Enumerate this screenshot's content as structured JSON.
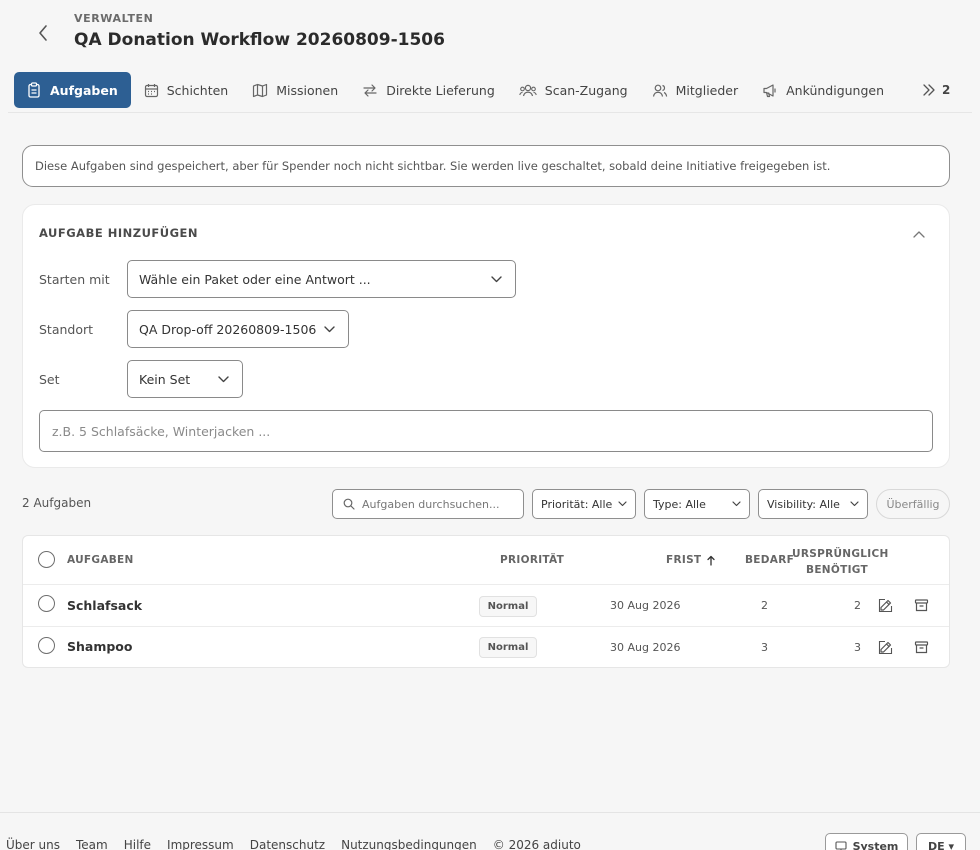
{
  "header": {
    "eyebrow": "VERWALTEN",
    "title": "QA Donation Workflow 20260809-1506"
  },
  "tabs": [
    {
      "label": "Aufgaben",
      "icon": "clipboard-icon",
      "active": true
    },
    {
      "label": "Schichten",
      "icon": "calendar-icon"
    },
    {
      "label": "Missionen",
      "icon": "map-icon"
    },
    {
      "label": "Direkte Lieferung",
      "icon": "arrows-exchange-icon"
    },
    {
      "label": "Scan-Zugang",
      "icon": "users-icon"
    },
    {
      "label": "Mitglieder",
      "icon": "user-icon"
    },
    {
      "label": "Ankündigungen",
      "icon": "megaphone-icon"
    }
  ],
  "tabs_more": {
    "count": "2",
    "icon": "double-chevron-right-icon"
  },
  "notice": "Diese Aufgaben sind gespeichert, aber für Spender noch nicht sichtbar. Sie werden live geschaltet, sobald deine Initiative freigegeben ist.",
  "add_task": {
    "title": "AUFGABE HINZUFÜGEN",
    "start_label": "Starten mit",
    "start_value": "Wähle ein Paket oder eine Antwort ...",
    "location_label": "Standort",
    "location_value": "QA Drop-off 20260809-1506",
    "set_label": "Set",
    "set_value": "Kein Set",
    "input_placeholder": "z.B. 5 Schlafsäcke, Winterjacken ..."
  },
  "toolbar": {
    "count": "2 Aufgaben",
    "search_placeholder": "Aufgaben durchsuchen...",
    "filter_priority": "Priorität: Alle",
    "filter_type": "Type: Alle",
    "filter_visibility": "Visibility: Alle",
    "overdue": "Überfällig"
  },
  "table": {
    "headers": {
      "task": "AUFGABEN",
      "priority": "PRIORITÄT",
      "due": "FRIST",
      "need": "BEDARF",
      "original_1": "URSPRÜNGLICH",
      "original_2": "BENÖTIGT"
    },
    "rows": [
      {
        "name": "Schlafsack",
        "priority": "Normal",
        "due": "30 Aug 2026",
        "need": "2",
        "original": "2"
      },
      {
        "name": "Shampoo",
        "priority": "Normal",
        "due": "30 Aug 2026",
        "need": "3",
        "original": "3"
      }
    ]
  },
  "footer": {
    "links": [
      "Über uns",
      "Team",
      "Hilfe",
      "Impressum",
      "Datenschutz",
      "Nutzungsbedingungen"
    ],
    "copyright": "© 2026 adiuto",
    "theme_button": "System",
    "language_button": "DE ▾"
  },
  "colors": {
    "accent": "#2d5f93",
    "background": "#f6f6f6"
  }
}
